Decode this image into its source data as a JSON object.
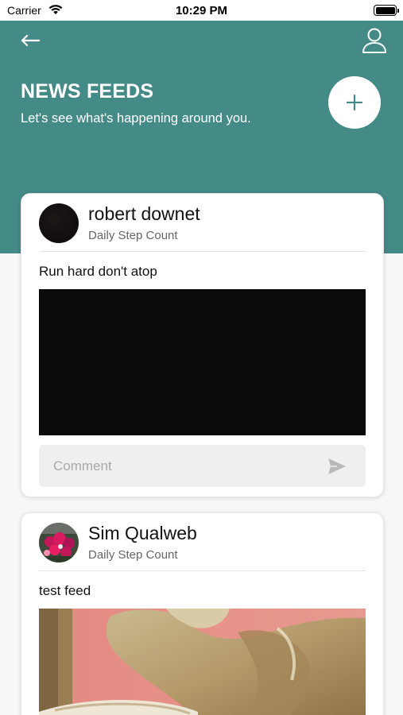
{
  "status_bar": {
    "carrier": "Carrier",
    "time": "10:29 PM"
  },
  "header": {
    "title": "NEWS FEEDS",
    "subtitle": "Let's see what's happening around you.",
    "accent_color": "#448a87",
    "back_icon": "arrow-left-icon",
    "profile_icon": "user-icon",
    "add_icon": "plus-icon"
  },
  "feeds": [
    {
      "author": "robert downet",
      "meta": "Daily Step Count",
      "text": "Run hard don't atop",
      "comment_placeholder": "Comment"
    },
    {
      "author": "Sim Qualweb",
      "meta": "Daily Step Count",
      "text": "test feed"
    }
  ]
}
